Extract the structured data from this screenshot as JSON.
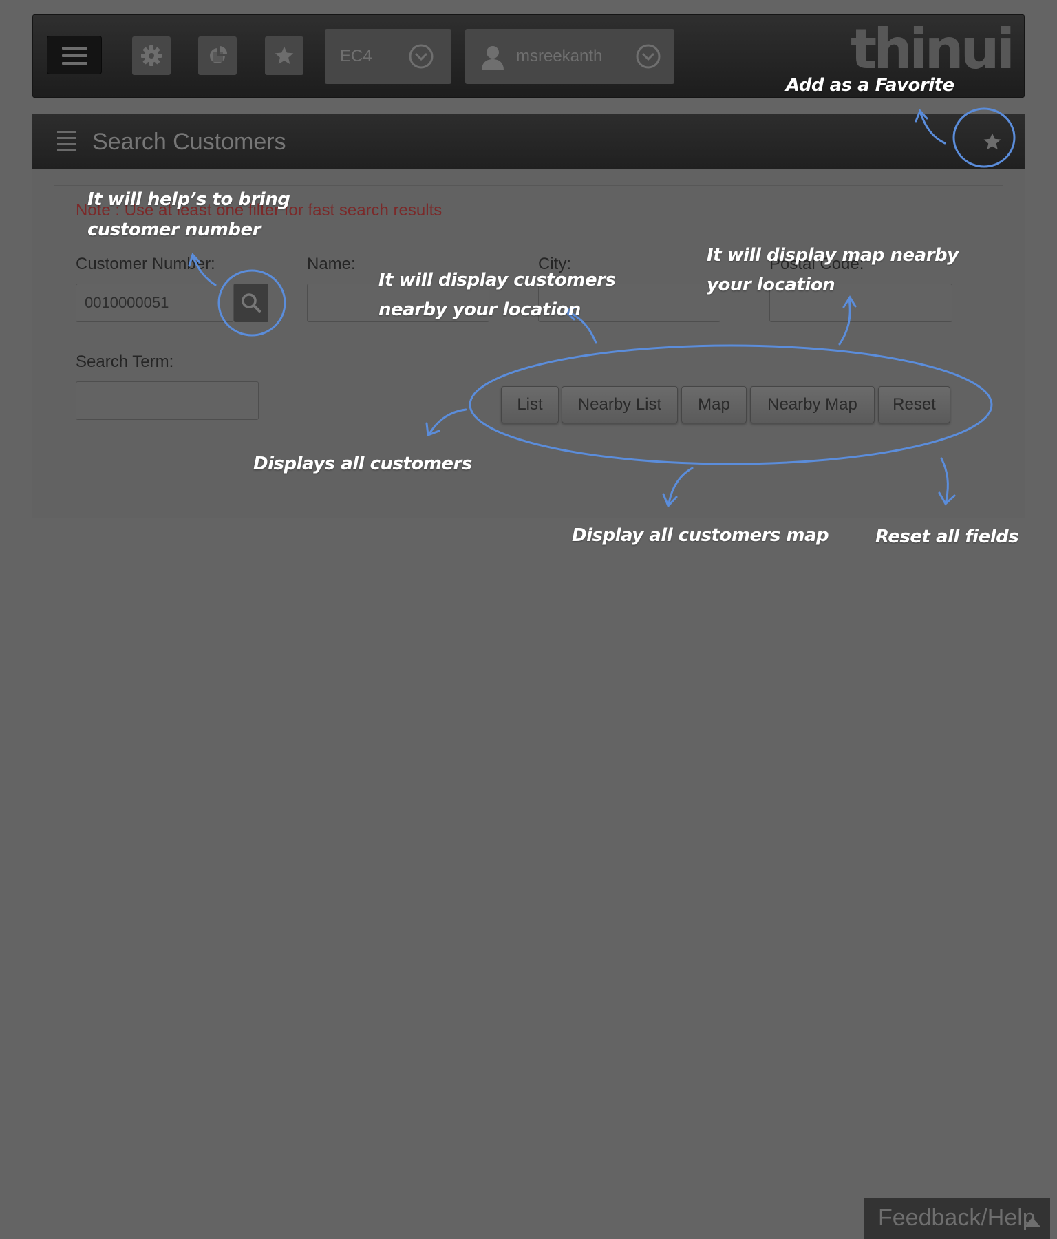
{
  "colors": {
    "background": "#646464",
    "topbar": "#1d1d1d",
    "note_text": "#7b2929",
    "annotation_stroke": "#5b8ddb",
    "annotation_text": "#ffffff"
  },
  "topbar": {
    "menu_icon": "hamburger-icon",
    "tools": [
      {
        "name": "settings-button",
        "icon": "gear-icon"
      },
      {
        "name": "reports-button",
        "icon": "chart-icon"
      },
      {
        "name": "favorites-button",
        "icon": "star-icon"
      }
    ],
    "system_select": {
      "value": "EC4"
    },
    "user_select": {
      "value": "msreekanth"
    },
    "logo": "thinui"
  },
  "panel": {
    "title": "Search Customers",
    "favorite_icon": "star-icon",
    "note": "Note : Use at least one filter for fast search results",
    "fields": {
      "customer_number": {
        "label": "Customer Number:",
        "value": "0010000051"
      },
      "name": {
        "label": "Name:",
        "value": ""
      },
      "city": {
        "label": "City:",
        "value": ""
      },
      "postal_code": {
        "label": "Postal Code:",
        "value": ""
      },
      "search_term": {
        "label": "Search Term:",
        "value": ""
      }
    },
    "buttons": {
      "list": "List",
      "nearby_list": "Nearby List",
      "map": "Map",
      "nearby_map": "Nearby Map",
      "reset": "Reset"
    }
  },
  "annotations": {
    "favorite": "Add as a Favorite",
    "customer_number_line1": "It will help’s to bring",
    "customer_number_line2": "customer number",
    "nearby_list_line1": "It will display customers",
    "nearby_list_line2": "nearby your location",
    "nearby_map_line1": "It will display map nearby",
    "nearby_map_line2": "your location",
    "list": "Displays all customers",
    "map": "Display all customers map",
    "reset": "Reset all fields"
  },
  "footer": {
    "feedback": "Feedback/Help",
    "feedback_icon": "caret-up-icon"
  }
}
